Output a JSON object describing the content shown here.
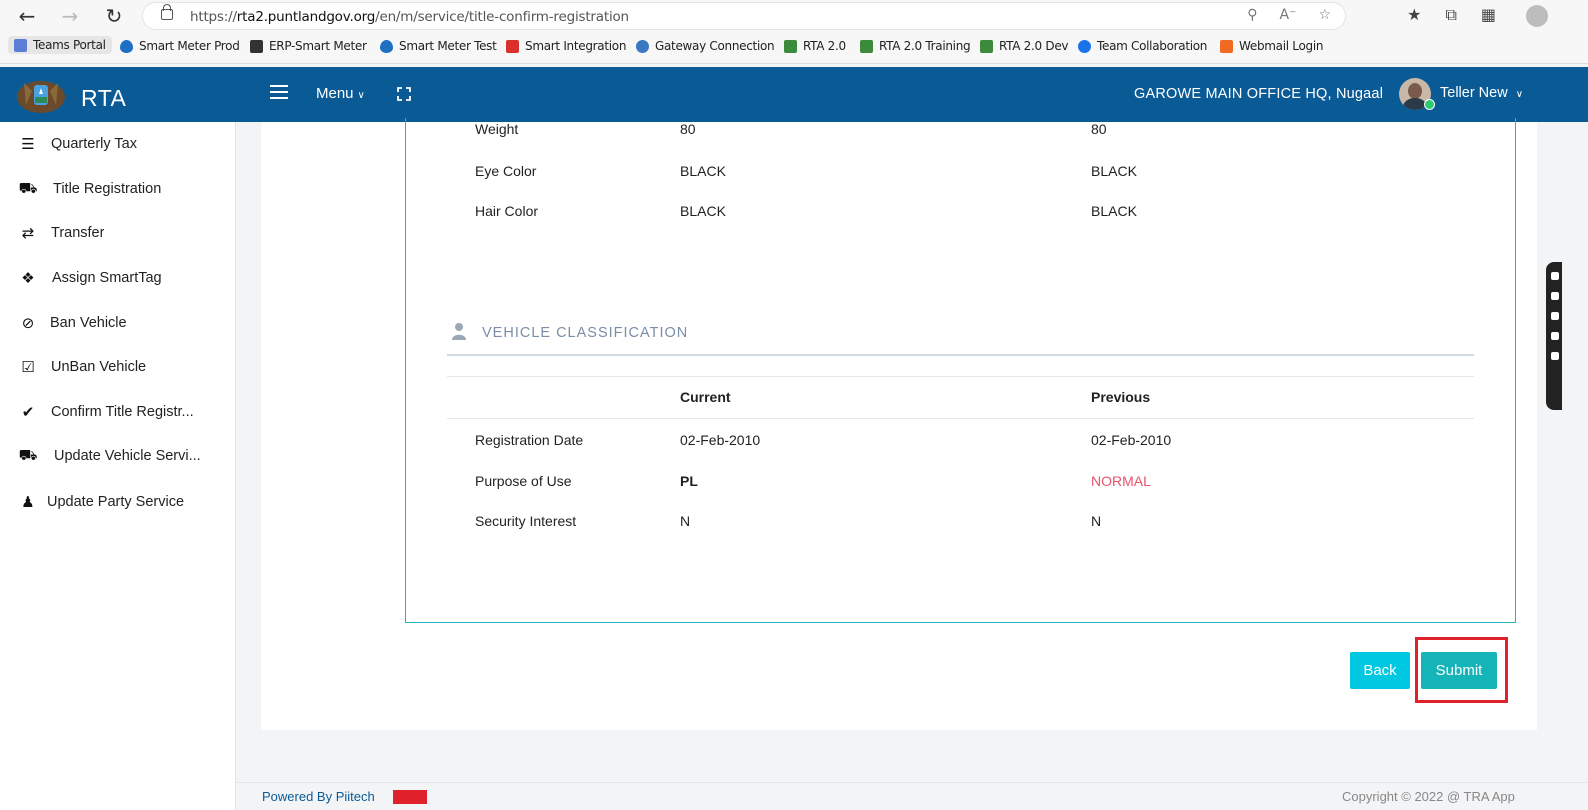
{
  "browser": {
    "url_prefix": "https://",
    "url_domain": "rta2.puntlandgov.org",
    "url_path": "/en/m/service/title-confirm-registration",
    "bookmarks": [
      {
        "label": "Teams Portal",
        "color": "#5b7fd6"
      },
      {
        "label": "Smart Meter Prod",
        "color": "#1f6fc2"
      },
      {
        "label": "ERP-Smart Meter",
        "color": "#333333"
      },
      {
        "label": "Smart Meter Test",
        "color": "#1f6fc2"
      },
      {
        "label": "Smart Integration",
        "color": "#d9302c"
      },
      {
        "label": "Gateway Connection",
        "color": "#3a78c2"
      },
      {
        "label": "RTA 2.0",
        "color": "#3c8a3c"
      },
      {
        "label": "RTA 2.0 Training",
        "color": "#3c8a3c"
      },
      {
        "label": "RTA 2.0 Dev",
        "color": "#3c8a3c"
      },
      {
        "label": "Team Collaboration",
        "color": "#1a73e8"
      },
      {
        "label": "Webmail Login",
        "color": "#f26a21"
      }
    ]
  },
  "header": {
    "brand": "RTA",
    "menu_label": "Menu",
    "office": "GAROWE MAIN OFFICE HQ, Nugaal",
    "user": "Teller New"
  },
  "sidebar": {
    "items": [
      {
        "label": "Quarterly Tax",
        "icon": "list-icon"
      },
      {
        "label": "Title Registration",
        "icon": "car-icon"
      },
      {
        "label": "Transfer",
        "icon": "exchange-icon"
      },
      {
        "label": "Assign SmartTag",
        "icon": "tags-icon"
      },
      {
        "label": "Ban Vehicle",
        "icon": "ban-icon"
      },
      {
        "label": "UnBan Vehicle",
        "icon": "check-square-icon"
      },
      {
        "label": "Confirm Title Registr...",
        "icon": "check-icon"
      },
      {
        "label": "Update Vehicle Servi...",
        "icon": "car-icon"
      },
      {
        "label": "Update Party Service",
        "icon": "user-icon"
      }
    ]
  },
  "person_rows": [
    {
      "label": "Weight",
      "current": "80",
      "previous": "80"
    },
    {
      "label": "Eye Color",
      "current": "BLACK",
      "previous": "BLACK"
    },
    {
      "label": "Hair Color",
      "current": "BLACK",
      "previous": "BLACK"
    }
  ],
  "classification": {
    "title": "VEHICLE CLASSIFICATION",
    "col_current": "Current",
    "col_previous": "Previous",
    "rows": [
      {
        "label": "Registration Date",
        "current": "02-Feb-2010",
        "previous": "02-Feb-2010"
      },
      {
        "label": "Purpose of Use",
        "current": "PL",
        "previous": "NORMAL"
      },
      {
        "label": "Security Interest",
        "current": "N",
        "previous": "N"
      }
    ]
  },
  "actions": {
    "back": "Back",
    "submit": "Submit"
  },
  "footer": {
    "left": "Powered By Piitech",
    "right": "Copyright © 2022 @ TRA App"
  },
  "colors": {
    "header": "#0a5a96",
    "accent_teal": "#15b4b8",
    "back_cyan": "#00c8e0",
    "warning_red": "#e8536a"
  }
}
